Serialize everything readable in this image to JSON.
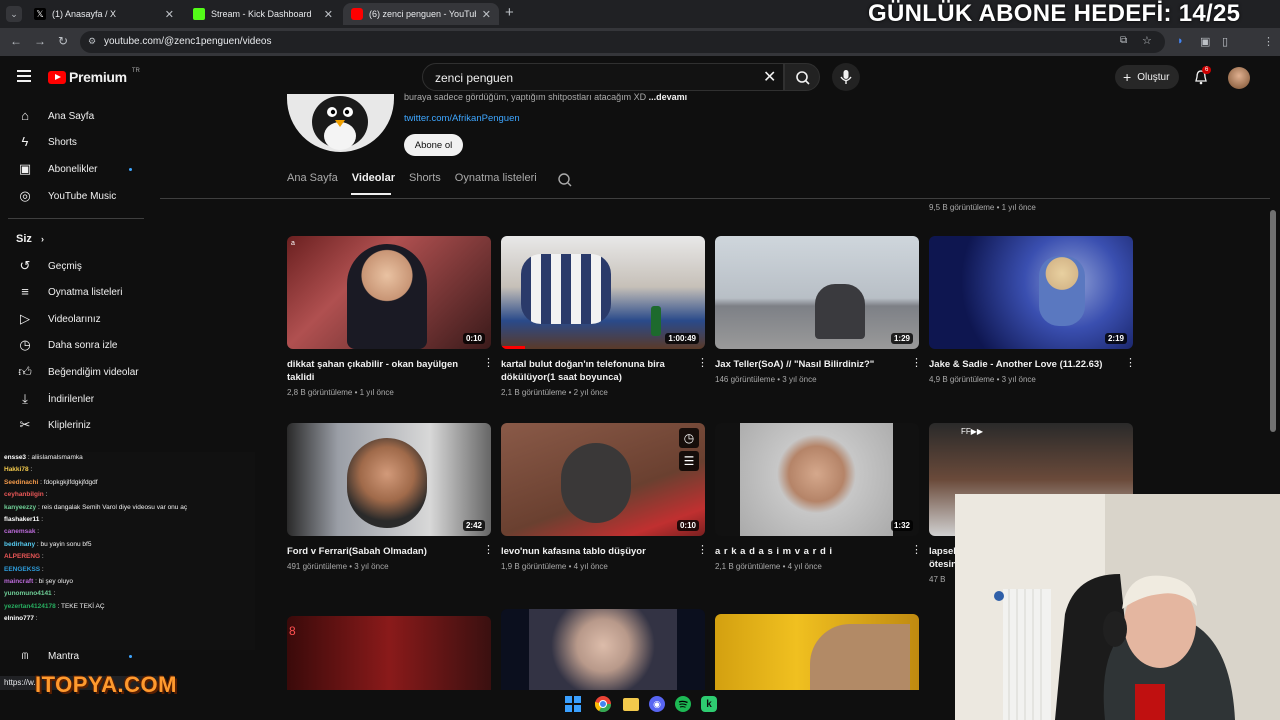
{
  "browser": {
    "tabs": [
      {
        "title": "(1) Anasayfa / X",
        "active": false
      },
      {
        "title": "Stream - Kick Dashboard",
        "active": false
      },
      {
        "title": "(6) zenci penguen - YouTube",
        "active": true
      }
    ],
    "url": "youtube.com/@zenc1penguen/videos"
  },
  "overlay": {
    "goal_text": "GÜNLÜK ABONE HEDEFİ: 14/25",
    "sponsor": "ITOPYA.COM"
  },
  "masthead": {
    "logo_text": "Premium",
    "logo_country": "TR",
    "search_value": "zenci penguen",
    "create_label": "Oluştur",
    "notification_count": "6"
  },
  "sidebar": {
    "main": [
      {
        "label": "Ana Sayfa",
        "icon": "home-icon"
      },
      {
        "label": "Shorts",
        "icon": "shorts-icon"
      },
      {
        "label": "Abonelikler",
        "icon": "subscriptions-icon"
      },
      {
        "label": "YouTube Music",
        "icon": "music-icon"
      }
    ],
    "you_label": "Siz",
    "you": [
      {
        "label": "Geçmiş",
        "icon": "history-icon"
      },
      {
        "label": "Oynatma listeleri",
        "icon": "playlist-icon"
      },
      {
        "label": "Videolarınız",
        "icon": "your-videos-icon"
      },
      {
        "label": "Daha sonra izle",
        "icon": "watch-later-icon"
      },
      {
        "label": "Beğendiğim videolar",
        "icon": "like-icon"
      },
      {
        "label": "İndirilenler",
        "icon": "download-icon"
      },
      {
        "label": "Klipleriniz",
        "icon": "clip-icon"
      }
    ],
    "bottom_item": "Mantra"
  },
  "channel": {
    "description": "buraya sadece gördüğüm, yaptığım shitpostları atacağım XD",
    "more": "...devamı",
    "link": "twitter.com/AfrikanPenguen",
    "subscribe_label": "Abone ol",
    "tabs": [
      "Ana Sayfa",
      "Videolar",
      "Shorts",
      "Oynatma listeleri"
    ],
    "active_tab": "Videolar"
  },
  "top_row_meta": [
    "9,5 B görüntüleme • 1 yıl önce"
  ],
  "videos": [
    {
      "title": "dikkat şahan çıkabilir - okan bayülgen taklidi",
      "meta": "2,8 B görüntüleme • 1 yıl önce",
      "duration": "0:10"
    },
    {
      "title": "kartal bulut doğan'ın telefonuna bira dökülüyor(1 saat boyunca)",
      "meta": "2,1 B görüntüleme • 2 yıl önce",
      "duration": "1:00:49"
    },
    {
      "title": "Jax Teller(SoA) // \"Nasıl Bilirdiniz?\"",
      "meta": "146 görüntüleme • 3 yıl önce",
      "duration": "1:29"
    },
    {
      "title": "Jake & Sadie - Another Love (11.22.63)",
      "meta": "4,9 B görüntüleme • 3 yıl önce",
      "duration": "2:19"
    },
    {
      "title": "Ford v Ferrari(Sabah Olmadan)",
      "meta": "491 görüntüleme • 3 yıl önce",
      "duration": "2:42"
    },
    {
      "title": "levo'nun kafasına tablo düşüyor",
      "meta": "1,9 B görüntüleme • 4 yıl önce",
      "duration": "0:10"
    },
    {
      "title": "a r k a d a s i m v a r d i",
      "meta": "2,1 B görüntüleme • 4 yıl önce",
      "duration": "1:32"
    },
    {
      "title": "lapsek ötesin",
      "meta": "47 B",
      "duration": ""
    }
  ],
  "chat": [
    {
      "user": "ensse3",
      "text": "aliislamalsmamka",
      "color": "#ffffff"
    },
    {
      "user": "Hakki78",
      "text": "",
      "color": "#f2c94c"
    },
    {
      "user": "Seedinachi",
      "text": "fdopkgkjlfdgkjfdgdf",
      "color": "#f2994a"
    },
    {
      "user": "ceyhanbilgin",
      "text": "",
      "color": "#eb5757"
    },
    {
      "user": "kanyeezzy",
      "text": "reis dangalak Semih Varol diye videosu var onu aç",
      "color": "#6fcf97"
    },
    {
      "user": "flashaker11",
      "text": "",
      "color": "#ffffff"
    },
    {
      "user": "canemsak",
      "text": "",
      "color": "#bb6bd9"
    },
    {
      "user": "bedirhany",
      "text": "bu yayin sonu bf5",
      "color": "#56ccf2"
    },
    {
      "user": "ALPERENG",
      "text": "",
      "color": "#eb5757"
    },
    {
      "user": "EENGEKSS",
      "text": "",
      "color": "#2d9cdb"
    },
    {
      "user": "maincraft",
      "text": "bi şey oluyo",
      "color": "#bb6bd9"
    },
    {
      "user": "yunomuno4141",
      "text": "",
      "color": "#6fcf97"
    },
    {
      "user": "yezertan4124178",
      "text": "TEKE TEKİ AÇ",
      "color": "#27ae60"
    },
    {
      "user": "elnino777",
      "text": "",
      "color": "#ffffff"
    }
  ],
  "status_url": "https://w...",
  "taskbar": [
    "windows-icon",
    "chrome-icon",
    "explorer-icon",
    "discord-icon",
    "spotify-icon",
    "kick-icon"
  ]
}
